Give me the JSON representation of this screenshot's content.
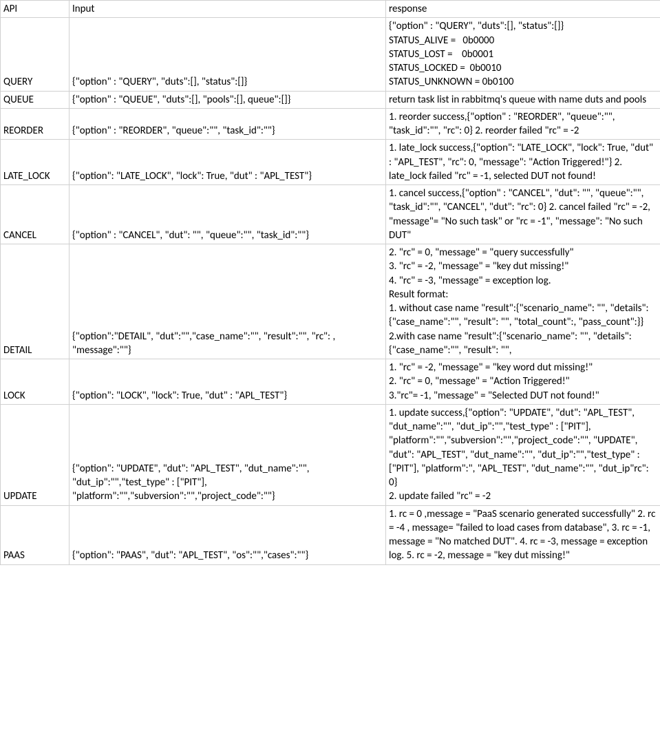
{
  "headers": {
    "api": "API",
    "input": "Input",
    "response": "response"
  },
  "rows": [
    {
      "api": "QUERY",
      "input": "{\"option\" : \"QUERY\", \"duts\":[], \"status\":[]}",
      "response": "{\"option\" : \"QUERY\", \"duts\":[], \"status\":[]}\nSTATUS_ALIVE =   0b0000\nSTATUS_LOST =    0b0001\nSTATUS_LOCKED =  0b0010\nSTATUS_UNKNOWN = 0b0100"
    },
    {
      "api": "QUEUE",
      "input": "{\"option\" : \"QUEUE\", \"duts\":[], \"pools\":[], queue\":[]}",
      "response": "return task list in rabbitmq's queue with name duts and pools"
    },
    {
      "api": "REORDER",
      "input": "{\"option\" : \"REORDER\", \"queue\":\"\", \"task_id\":\"\"}",
      "response": "1. reorder success,{\"option\" : \"REORDER\", \"queue\":\"\", \"task_id\":\"\", \"rc\": 0} 2. reorder failed \"rc\" = -2"
    },
    {
      "api": "LATE_LOCK",
      "input": "{\"option\": \"LATE_LOCK\", \"lock\": True, \"dut\" : \"APL_TEST\"}",
      "response": "1. late_lock success,{\"option\": \"LATE_LOCK\", \"lock\": True, \"dut\" : \"APL_TEST\", \"rc\": 0, \"message\": \"Action Triggered!\"} 2. late_lock failed \"rc\" = -1, selected DUT not found!"
    },
    {
      "api": "CANCEL",
      "input": "{\"option\" : \"CANCEL\", \"dut\": \"\", \"queue\":\"\", \"task_id\":\"\"}",
      "response": "1. cancel success,{\"option\" : \"CANCEL\", \"dut\": \"\", \"queue\":\"\", \"task_id\":\"\", \"CANCEL\", \"dut\": \"rc\": 0} 2. cancel failed \"rc\" = -2, \"message\"= \"No such task\" or \"rc = -1\", \"message\": \"No such DUT\""
    },
    {
      "api": "DETAIL",
      "input": "{\"option\":\"DETAIL\", \"dut\":\"\",\"case_name\":\"\", \"result\":\"\", \"rc\": , \"message\":\"\"}",
      "response": "2. \"rc\" = 0, \"message\" = \"query successfully\"\n3. \"rc\" = -2, \"message\" = \"key dut missing!\"\n4. \"rc\" = -3, \"message\" = exception log.\nResult format:\n1. without case name \"result\":{\"scenario_name\": \"\", \"details\":{\"case_name\":\"\", \"result\": \"\", \"total_count\":, \"pass_count\":}}\n2.with case name \"result\":{\"scenario_name\": \"\", \"details\":{\"case_name\":\"\", \"result\": \"\","
    },
    {
      "api": "LOCK",
      "input": "{\"option\": \"LOCK\", \"lock\": True, \"dut\" : \"APL_TEST\"}",
      "response": "1. \"rc\" = -2, \"message\" = \"key word dut missing!\"\n2. \"rc\" = 0, \"message\" = \"Action Triggered!\"\n3.\"rc\"= -1, \"message\" = \"Selected DUT not found!\""
    },
    {
      "api": "UPDATE",
      "input": "{\"option\": \"UPDATE\", \"dut\": \"APL_TEST\", \"dut_name\":\"\", \"dut_ip\":\"\",\"test_type\" : [\"PIT\"], \"platform\":\"\",\"subversion\":\"\",\"project_code\":\"\"}",
      "response": "1. update success,{\"option\": \"UPDATE\", \"dut\": \"APL_TEST\", \"dut_name\":\"\", \"dut_ip\":\"\",\"test_type\" : [\"PIT\"], \"platform\":\"\",\"subversion\":\"\",\"project_code\":\"\", \"UPDATE\", \"dut\": \"APL_TEST\", \"dut_name\":\"\", \"dut_ip\":\"\",\"test_type\" : [\"PIT\"], \"platform\":\", \"APL_TEST\", \"dut_name\":\"\", \"dut_ip\"rc\": 0}\n2. update failed \"rc\" = -2"
    },
    {
      "api": "PAAS",
      "input": "{\"option\": \"PAAS\", \"dut\": \"APL_TEST\", \"os\":\"\",\"cases\":\"\"}",
      "response": "1. rc = 0 ,message = \"PaaS scenario generated successfully\" 2. rc = -4 , message= \"failed to load cases from database\", 3. rc = -1, message = \"No matched DUT\". 4. rc = -3, message = exception log. 5. rc = -2, message = \"key dut missing!\""
    }
  ]
}
